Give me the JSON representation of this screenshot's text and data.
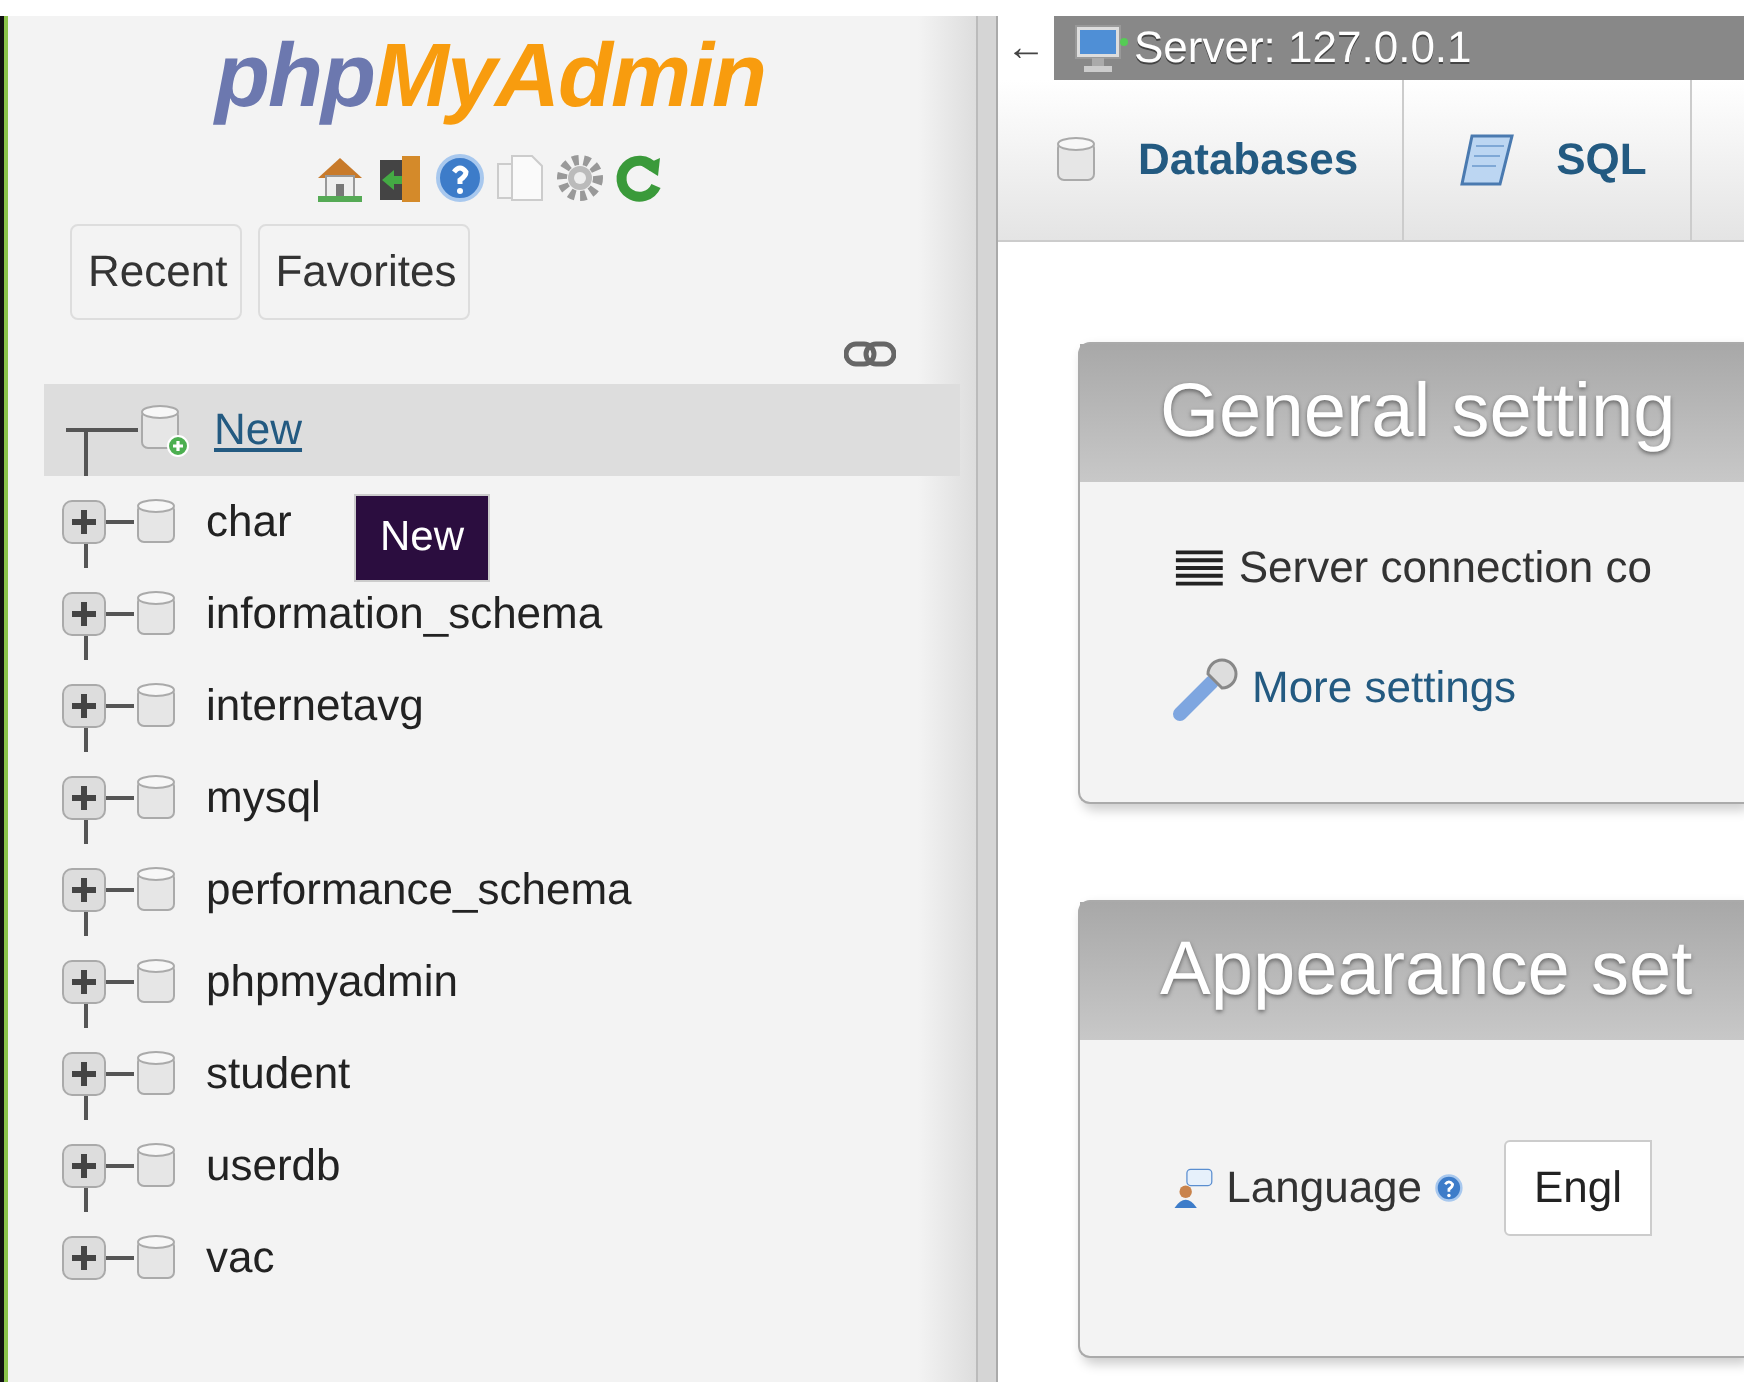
{
  "navigation": {
    "logo": {
      "first": "php",
      "second": "MyAdmin"
    },
    "tabs": [
      {
        "label": "Recent"
      },
      {
        "label": "Favorites"
      }
    ],
    "new_item": {
      "label": "New",
      "highlighted": true
    },
    "databases": [
      {
        "name": "char",
        "expanded": false
      },
      {
        "name": "information_schema",
        "expanded": false
      },
      {
        "name": "internetavg",
        "expanded": false
      },
      {
        "name": "mysql",
        "expanded": false
      },
      {
        "name": "performance_schema",
        "expanded": false
      },
      {
        "name": "phpmyadmin",
        "expanded": false
      },
      {
        "name": "student",
        "expanded": false
      },
      {
        "name": "userdb",
        "expanded": false
      },
      {
        "name": "vac",
        "expanded": false
      }
    ],
    "tooltip": {
      "text": "New"
    }
  },
  "breadcrumb": {
    "back": "←",
    "text": "Server: 127.0.0.1"
  },
  "tabs": [
    {
      "label": "Databases",
      "kind": "database"
    },
    {
      "label": "SQL",
      "kind": "sql"
    }
  ],
  "panels": [
    {
      "title": "General setting",
      "items": [
        {
          "kind": "list",
          "label": "Server connection co"
        },
        {
          "kind": "wrench",
          "label": "More settings"
        }
      ]
    },
    {
      "title": "Appearance set",
      "items": [
        {
          "kind": "language",
          "label": "Language",
          "value": "Engl"
        }
      ]
    }
  ]
}
